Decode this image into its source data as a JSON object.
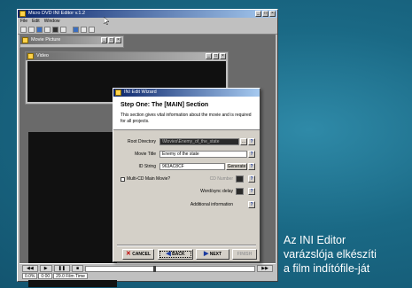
{
  "app": {
    "title": "Micro DVD INI Editor v.1.2",
    "menu": [
      "File",
      "Edit",
      "Window"
    ]
  },
  "child_windows": {
    "movie_title": "Movie Picture",
    "video_title": "Video"
  },
  "wizard": {
    "title": "INI Edit Wizard",
    "heading": "Step One: The [MAIN] Section",
    "description": "This section gives vital information about the movie and is required for all projects.",
    "fields": {
      "root_directory_label": "Root Directory",
      "root_directory_value": "\\Movies\\Enemy_of_the_state",
      "movie_title_label": "Movie Title",
      "movie_title_value": "Enemy of the state",
      "id_string_label": "ID String",
      "id_string_value": "963AC8CF",
      "generate_label": "Generate",
      "multi_cd_label": "Multi-CD Main Movie?",
      "cd_number_label": "CD Number",
      "word_sync_label": "Word/sync delay",
      "additional_label": "Additional information",
      "help_glyph": "?",
      "browse_glyph": "..."
    },
    "buttons": {
      "cancel": "CANCEL",
      "back": "BACK",
      "next": "NEXT",
      "finish": "FINISH"
    }
  },
  "player": {
    "status_cells": [
      "0.0%",
      "0:00",
      "29.0 Film Time"
    ]
  },
  "caption": {
    "lines": [
      "Az INI Editor",
      "varázslója elkészíti",
      "a film indítófile-ját"
    ]
  },
  "colors": {
    "background": "#1f6f8c",
    "titlebar": "#0a246a",
    "caption_text": "#ffffff"
  }
}
